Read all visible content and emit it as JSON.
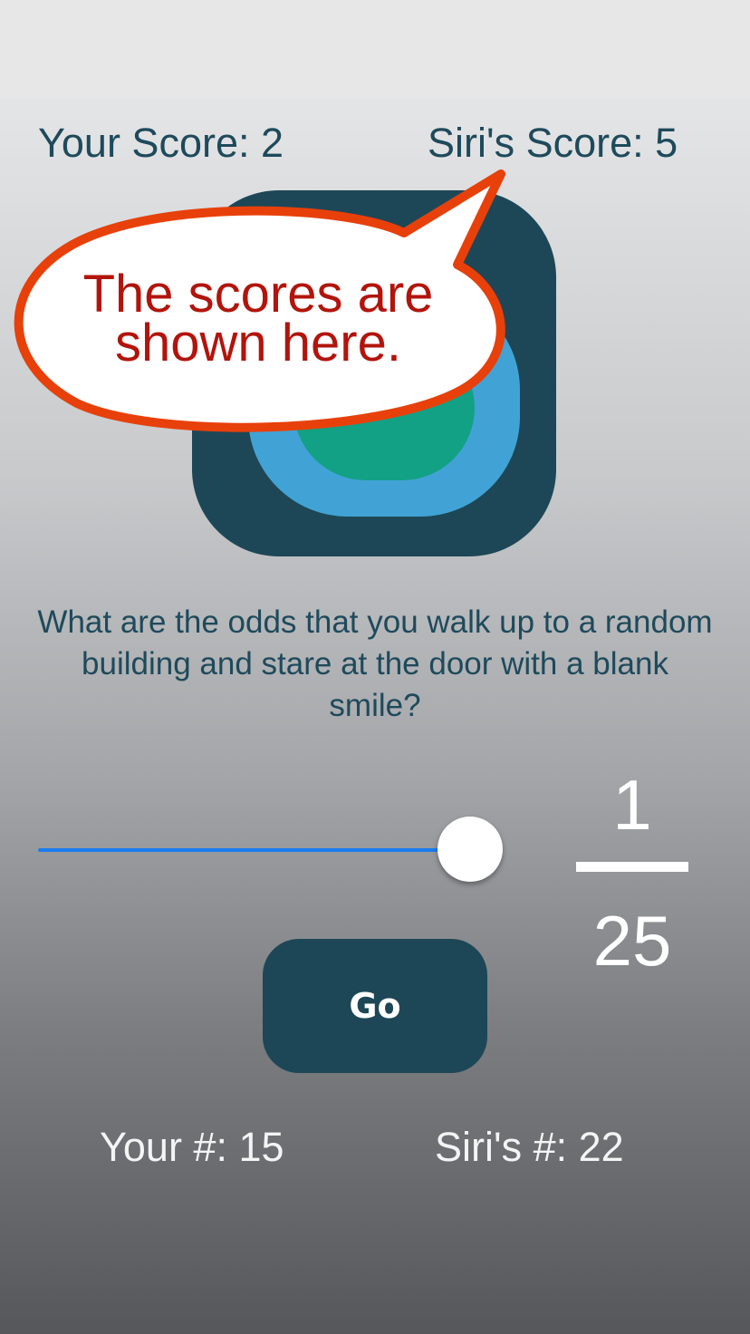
{
  "scores": {
    "your_score": "Your Score: 2",
    "siri_score": "Siri's Score: 5"
  },
  "callout": {
    "line1": "The scores are",
    "line2": "shown here."
  },
  "question": "What are the odds that you walk up to a random building and stare at the door with a blank smile?",
  "slider": {
    "value_fraction": 0.92
  },
  "odds": {
    "numerator": "1",
    "denominator": "25"
  },
  "go_button": {
    "label": "Go"
  },
  "picks": {
    "your_pick": "Your #: 15",
    "siri_pick": "Siri's #: 22"
  },
  "colors": {
    "accent_dark": "#1d4756",
    "slider_blue": "#1a7cf0",
    "callout_red": "#b2140c",
    "callout_border": "#e8400a"
  }
}
